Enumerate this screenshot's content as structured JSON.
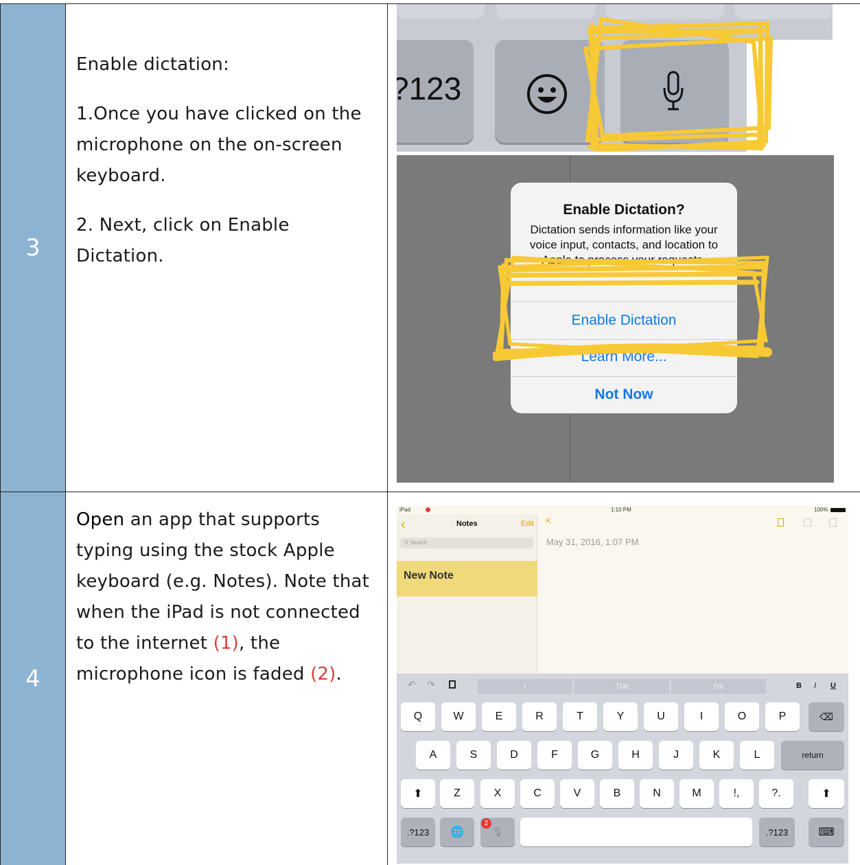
{
  "rows": [
    {
      "number": "3",
      "heading": "Enable dictation:",
      "steps": [
        "1.Once you have clicked on the microphone on the on-screen keyboard.",
        "2. Next, click on Enable Dictation."
      ]
    },
    {
      "number": "4",
      "text_open": "Open",
      "text_part1": " an app that supports typing using the stock Apple keyboard (e.g. Notes).  Note that when the iPad is not connected to the internet ",
      "text_ref1": "(1)",
      "text_part2": ", the microphone icon is faded ",
      "text_ref2": "(2)",
      "text_part3": "."
    }
  ],
  "keyboard_zoom": {
    "key_label": "?123",
    "emoji_icon": "smiley-face-icon",
    "mic_icon": "microphone-icon",
    "highlight_color": "#f7c934"
  },
  "dialog": {
    "title": "Enable Dictation?",
    "message": "Dictation sends information like your voice input, contacts, and location to Apple to process your requests.",
    "enable_button": "Enable Dictation",
    "learn_more_button": "Learn More...",
    "not_now_button": "Not Now",
    "accent_color": "#1478e8"
  },
  "ipad": {
    "status_device": "iPad",
    "status_time": "1:10 PM",
    "status_battery": "100%",
    "notes_title": "Notes",
    "edit_label": "Edit",
    "search_placeholder": "Search",
    "note_item": "New Note",
    "note_date": "May 31, 2016, 1:07 PM",
    "suggestions": [
      "I",
      "The",
      "I'm"
    ],
    "format_labels": [
      "B",
      "I",
      "U"
    ],
    "keys_row1": [
      "Q",
      "W",
      "E",
      "R",
      "T",
      "Y",
      "U",
      "I",
      "O",
      "P"
    ],
    "keys_row2": [
      "A",
      "S",
      "D",
      "F",
      "G",
      "H",
      "J",
      "K",
      "L"
    ],
    "return_label": "return",
    "keys_row3": [
      "Z",
      "X",
      "C",
      "V",
      "B",
      "N",
      "M",
      "!,",
      "?."
    ],
    "numbers_key": ".?123",
    "mic_badge": "2"
  }
}
